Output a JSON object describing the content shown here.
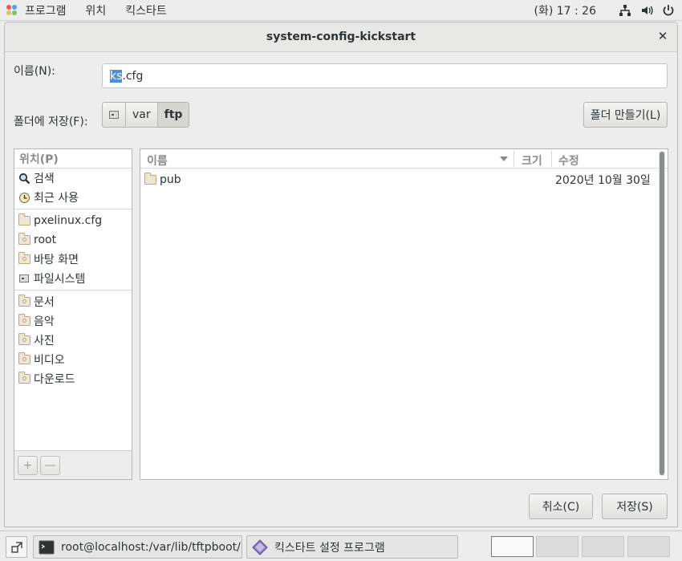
{
  "top_panel": {
    "apps_label": "프로그램",
    "places_label": "위치",
    "app_label": "킥스타트",
    "clock": "(화) 17 : 26",
    "icons": [
      "network-icon",
      "volume-icon",
      "power-icon"
    ]
  },
  "dialog": {
    "title": "system-config-kickstart",
    "name_label": "이름(N):",
    "filename_selected": "ks",
    "filename_rest": ".cfg",
    "folder_label": "폴더에 저장(F):",
    "path": [
      "var",
      "ftp"
    ],
    "mkdir_label": "폴더 만들기(L)",
    "places": {
      "header": "위치(P)",
      "items": [
        {
          "label": "검색",
          "icon": "search-icon"
        },
        {
          "label": "최근 사용",
          "icon": "recent-icon"
        },
        {
          "label": "pxelinux.cfg",
          "icon": "folder-icon"
        },
        {
          "label": "root",
          "icon": "home-folder-icon"
        },
        {
          "label": "바탕 화면",
          "icon": "desktop-folder-icon"
        },
        {
          "label": "파일시스템",
          "icon": "drive-icon"
        },
        {
          "label": "문서",
          "icon": "documents-folder-icon"
        },
        {
          "label": "음악",
          "icon": "music-folder-icon"
        },
        {
          "label": "사진",
          "icon": "pictures-folder-icon"
        },
        {
          "label": "비디오",
          "icon": "videos-folder-icon"
        },
        {
          "label": "다운로드",
          "icon": "downloads-folder-icon"
        }
      ],
      "add_label": "+",
      "remove_label": "—"
    },
    "files": {
      "columns": {
        "name": "이름",
        "size": "크기",
        "modified": "수정"
      },
      "rows": [
        {
          "name": "pub",
          "size": "",
          "modified": "2020년 10월 30일"
        }
      ]
    },
    "cancel_label": "취소(C)",
    "save_label": "저장(S)"
  },
  "taskbar": {
    "tasks": [
      {
        "label": "root@localhost:/var/lib/tftpboot/px…",
        "icon": "terminal-icon"
      },
      {
        "label": "킥스타트 설정 프로그램",
        "icon": "kickstart-icon"
      }
    ],
    "workspaces": 4,
    "active_workspace": 1
  },
  "colors": {
    "selection": "#4a90d9",
    "background": "#ededed"
  }
}
